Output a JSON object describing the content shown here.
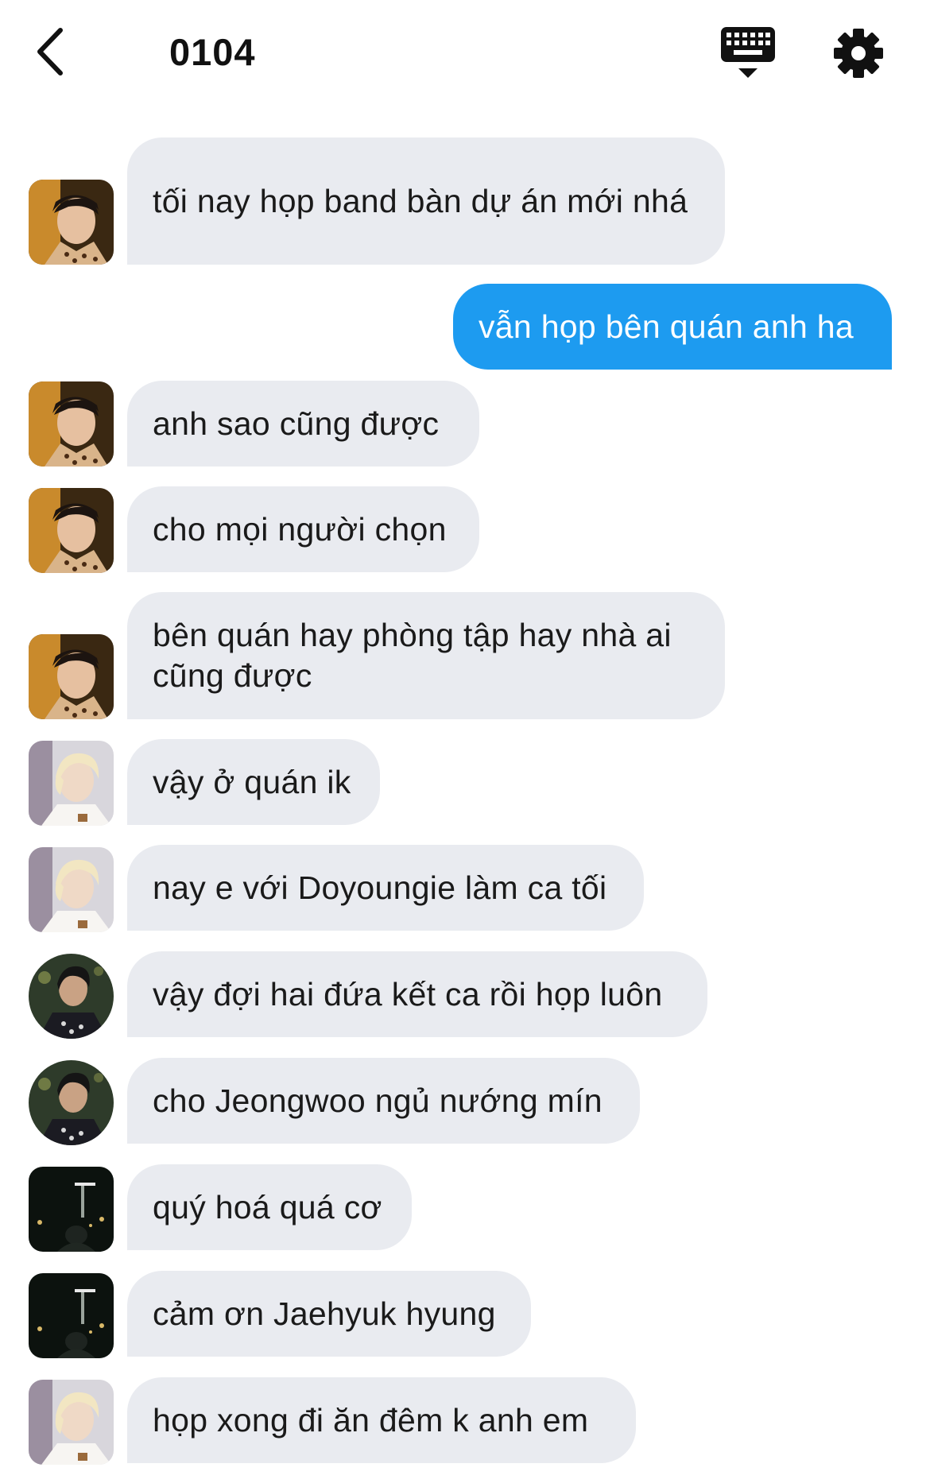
{
  "header": {
    "title": "0104",
    "back_icon": "chevron-left-icon",
    "keyboard_icon": "keyboard-icon",
    "settings_icon": "gear-icon"
  },
  "colors": {
    "incoming_bubble": "#e9ebf0",
    "outgoing_bubble": "#1d9bf0"
  },
  "messages": [
    {
      "sender": "member-1",
      "direction": "in",
      "text": "tối nay họp band bàn dự án mới nhá"
    },
    {
      "sender": "me",
      "direction": "out",
      "text": "vẫn họp bên quán anh ha"
    },
    {
      "sender": "member-1",
      "direction": "in",
      "text": "anh sao cũng được"
    },
    {
      "sender": "member-1",
      "direction": "in",
      "text": "cho mọi người chọn"
    },
    {
      "sender": "member-1",
      "direction": "in",
      "text": "bên quán hay phòng tập hay nhà ai cũng được"
    },
    {
      "sender": "member-2",
      "direction": "in",
      "text": "vậy ở quán ik"
    },
    {
      "sender": "member-2",
      "direction": "in",
      "text": "nay e với Doyoungie làm ca tối"
    },
    {
      "sender": "member-3",
      "direction": "in",
      "text": "vậy đợi hai đứa kết ca rồi họp luôn"
    },
    {
      "sender": "member-3",
      "direction": "in",
      "text": "cho Jeongwoo ngủ nướng mín"
    },
    {
      "sender": "member-4",
      "direction": "in",
      "text": "quý hoá quá cơ"
    },
    {
      "sender": "member-4",
      "direction": "in",
      "text": "cảm ơn Jaehyuk hyung"
    },
    {
      "sender": "member-2",
      "direction": "in",
      "text": "họp xong đi ăn đêm k anh em"
    }
  ]
}
